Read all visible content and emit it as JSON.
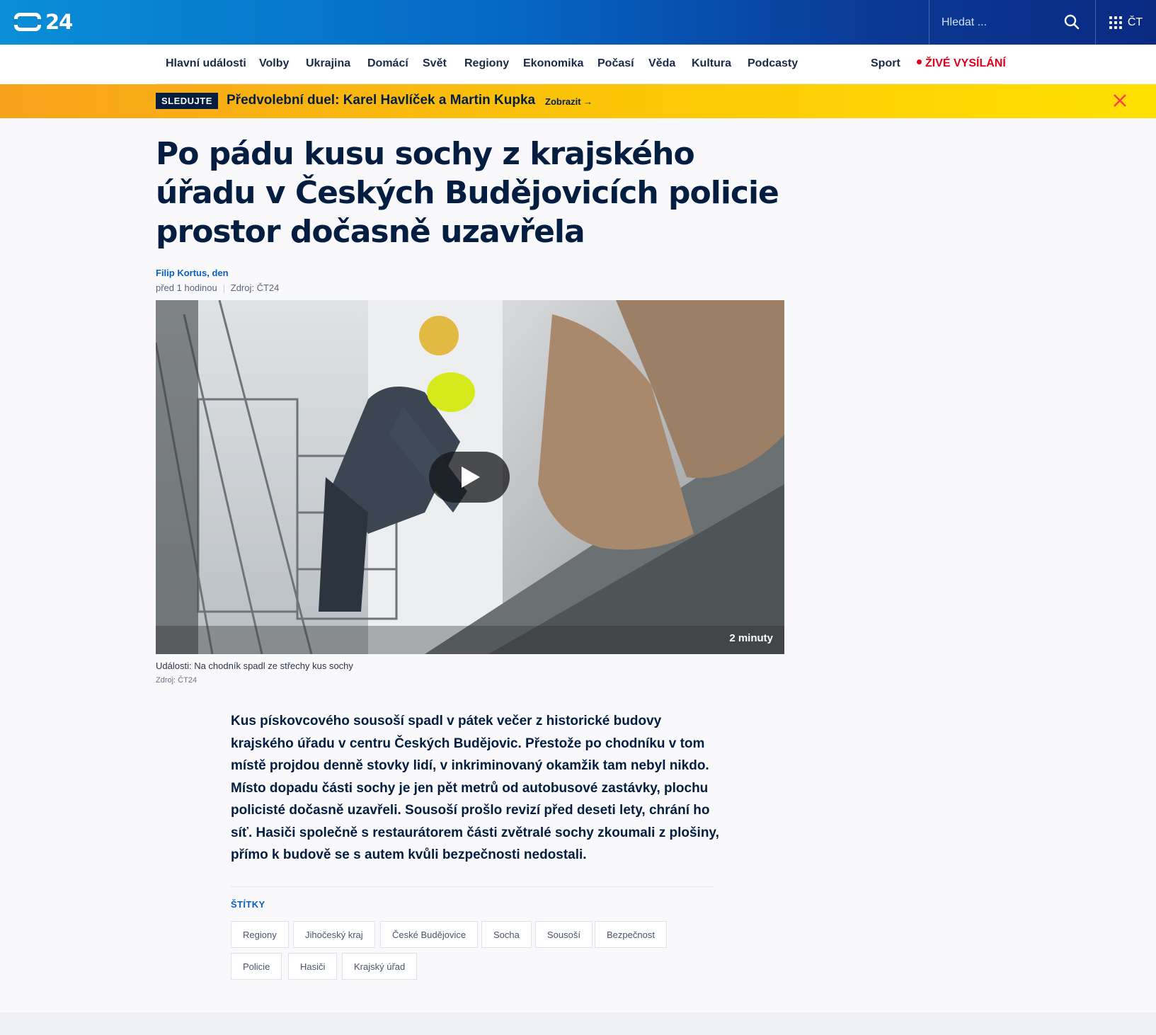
{
  "header": {
    "logo_text": "24",
    "search_placeholder": "Hledat ...",
    "ct_label": "ČT"
  },
  "nav": {
    "items": [
      "Hlavní události",
      "Volby",
      "Ukrajina",
      "Domácí",
      "Svět",
      "Regiony",
      "Ekonomika",
      "Počasí",
      "Věda",
      "Kultura",
      "Podcasty"
    ],
    "sport": "Sport",
    "live": "ŽIVÉ VYSÍLÁNÍ"
  },
  "banner": {
    "badge": "SLEDUJTE",
    "title": "Předvolební duel: Karel Havlíček a Martin Kupka",
    "link": "Zobrazit →"
  },
  "article": {
    "headline": "Po pádu kusu sochy z krajského úřadu v Českých Budějovicích policie prostor dočasně uzavřela",
    "author": "Filip Kortus, den",
    "time": "před 1 hodinou",
    "source": "Zdroj: ČT24",
    "video": {
      "duration": "2 minuty",
      "caption": "Události: Na chodník spadl ze střechy kus sochy",
      "caption_source": "Zdroj: ČT24"
    },
    "lead": "Kus pískovcového sousoší spadl v pátek večer z historické budovy krajského úřadu v centru Českých Budějovic. Přestože po chodníku v tom místě projdou denně stovky lidí, v inkriminovaný okamžik tam nebyl nikdo. Místo dopadu části sochy je jen pět metrů od autobusové zastávky, plochu policisté dočasně uzavřeli. Sousoší prošlo revizí před deseti lety, chrání ho síť. Hasiči společně s restaurátorem části zvětralé sochy zkoumali z plošiny, přímo k budově se s autem kvůli bezpečnosti nedostali."
  },
  "tags": {
    "title": "ŠTÍTKY",
    "items": [
      "Regiony",
      "Jihočeský kraj",
      "České Budějovice",
      "Socha",
      "Sousoší",
      "Bezpečnost",
      "Policie",
      "Hasiči",
      "Krajský úřad"
    ]
  },
  "colors": {
    "header_start": "#0a8fd6",
    "header_end": "#0a2a82",
    "banner_start": "#f7a21b",
    "banner_end": "#ffe100",
    "live_red": "#e3001b",
    "link_blue": "#0b5fc1",
    "text_dark": "#041e42"
  },
  "icons": [
    "logo-icon",
    "search-icon",
    "grid-menu-icon",
    "close-icon",
    "play-icon",
    "live-dot-icon"
  ]
}
